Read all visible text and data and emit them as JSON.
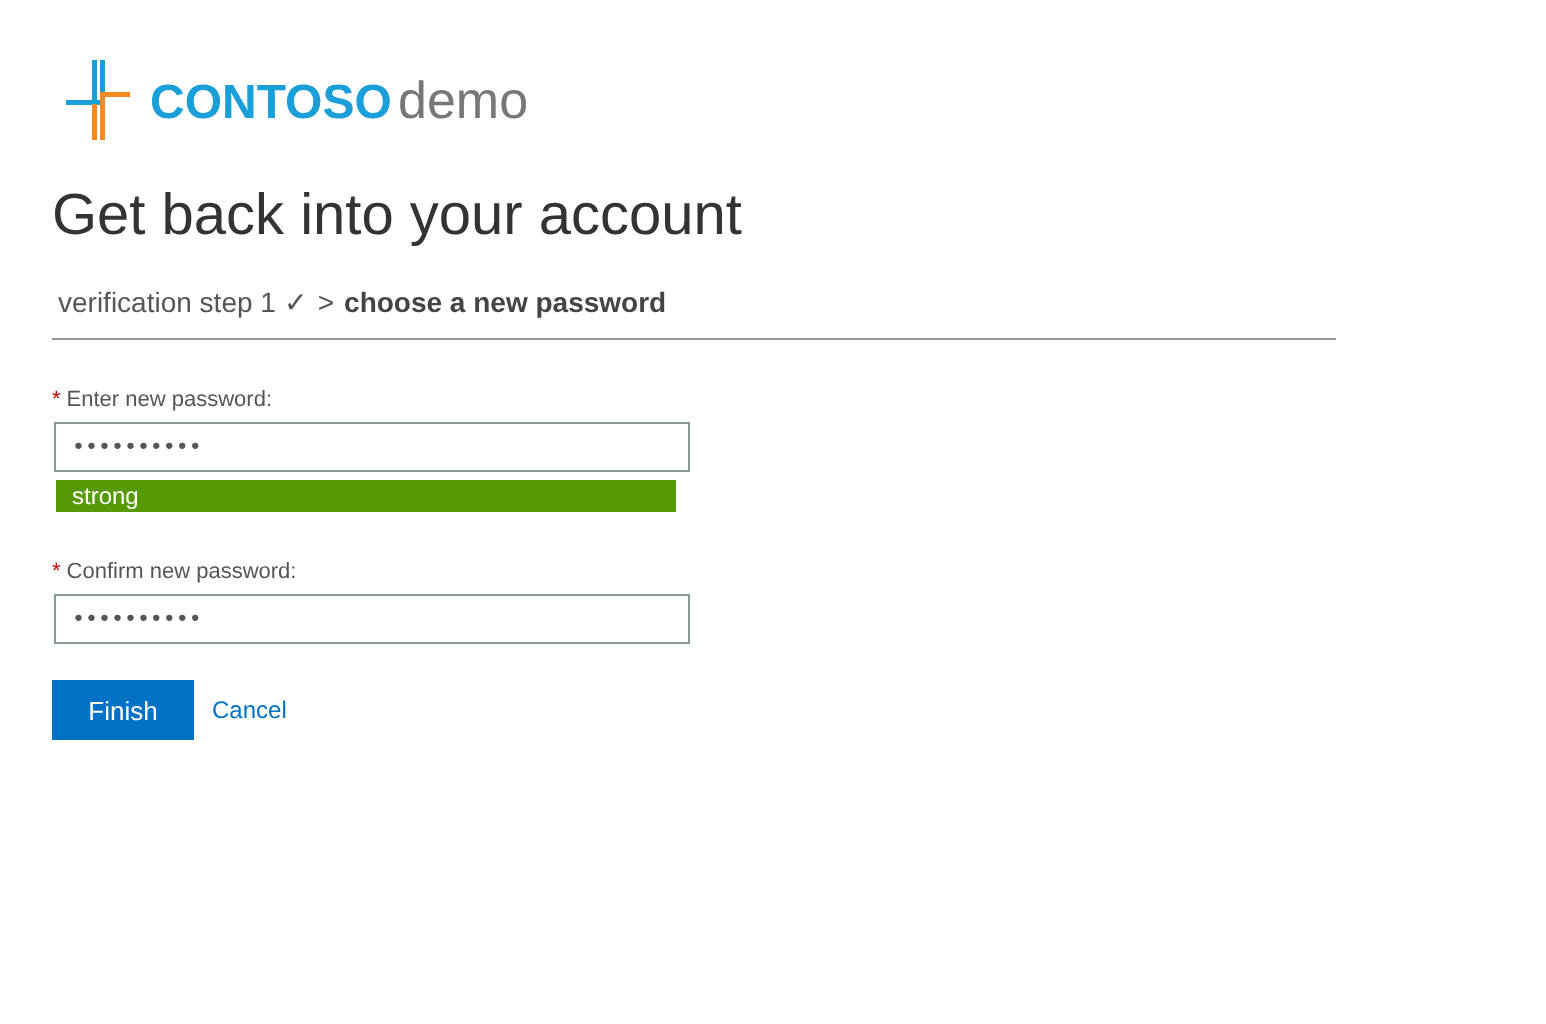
{
  "logo": {
    "brand": "CONTOSO",
    "suffix": "demo"
  },
  "title": "Get back into your account",
  "breadcrumb": {
    "step": "verification step 1 ✓",
    "separator": ">",
    "current": "choose a new password"
  },
  "fields": [
    {
      "required_mark": "*",
      "label": "Enter new password:",
      "value": "••••••••••",
      "strength": {
        "label": "strong",
        "level": 1
      }
    },
    {
      "required_mark": "*",
      "label": "Confirm new password:",
      "value": "••••••••••"
    }
  ],
  "buttons": {
    "primary": "Finish",
    "link": "Cancel"
  }
}
